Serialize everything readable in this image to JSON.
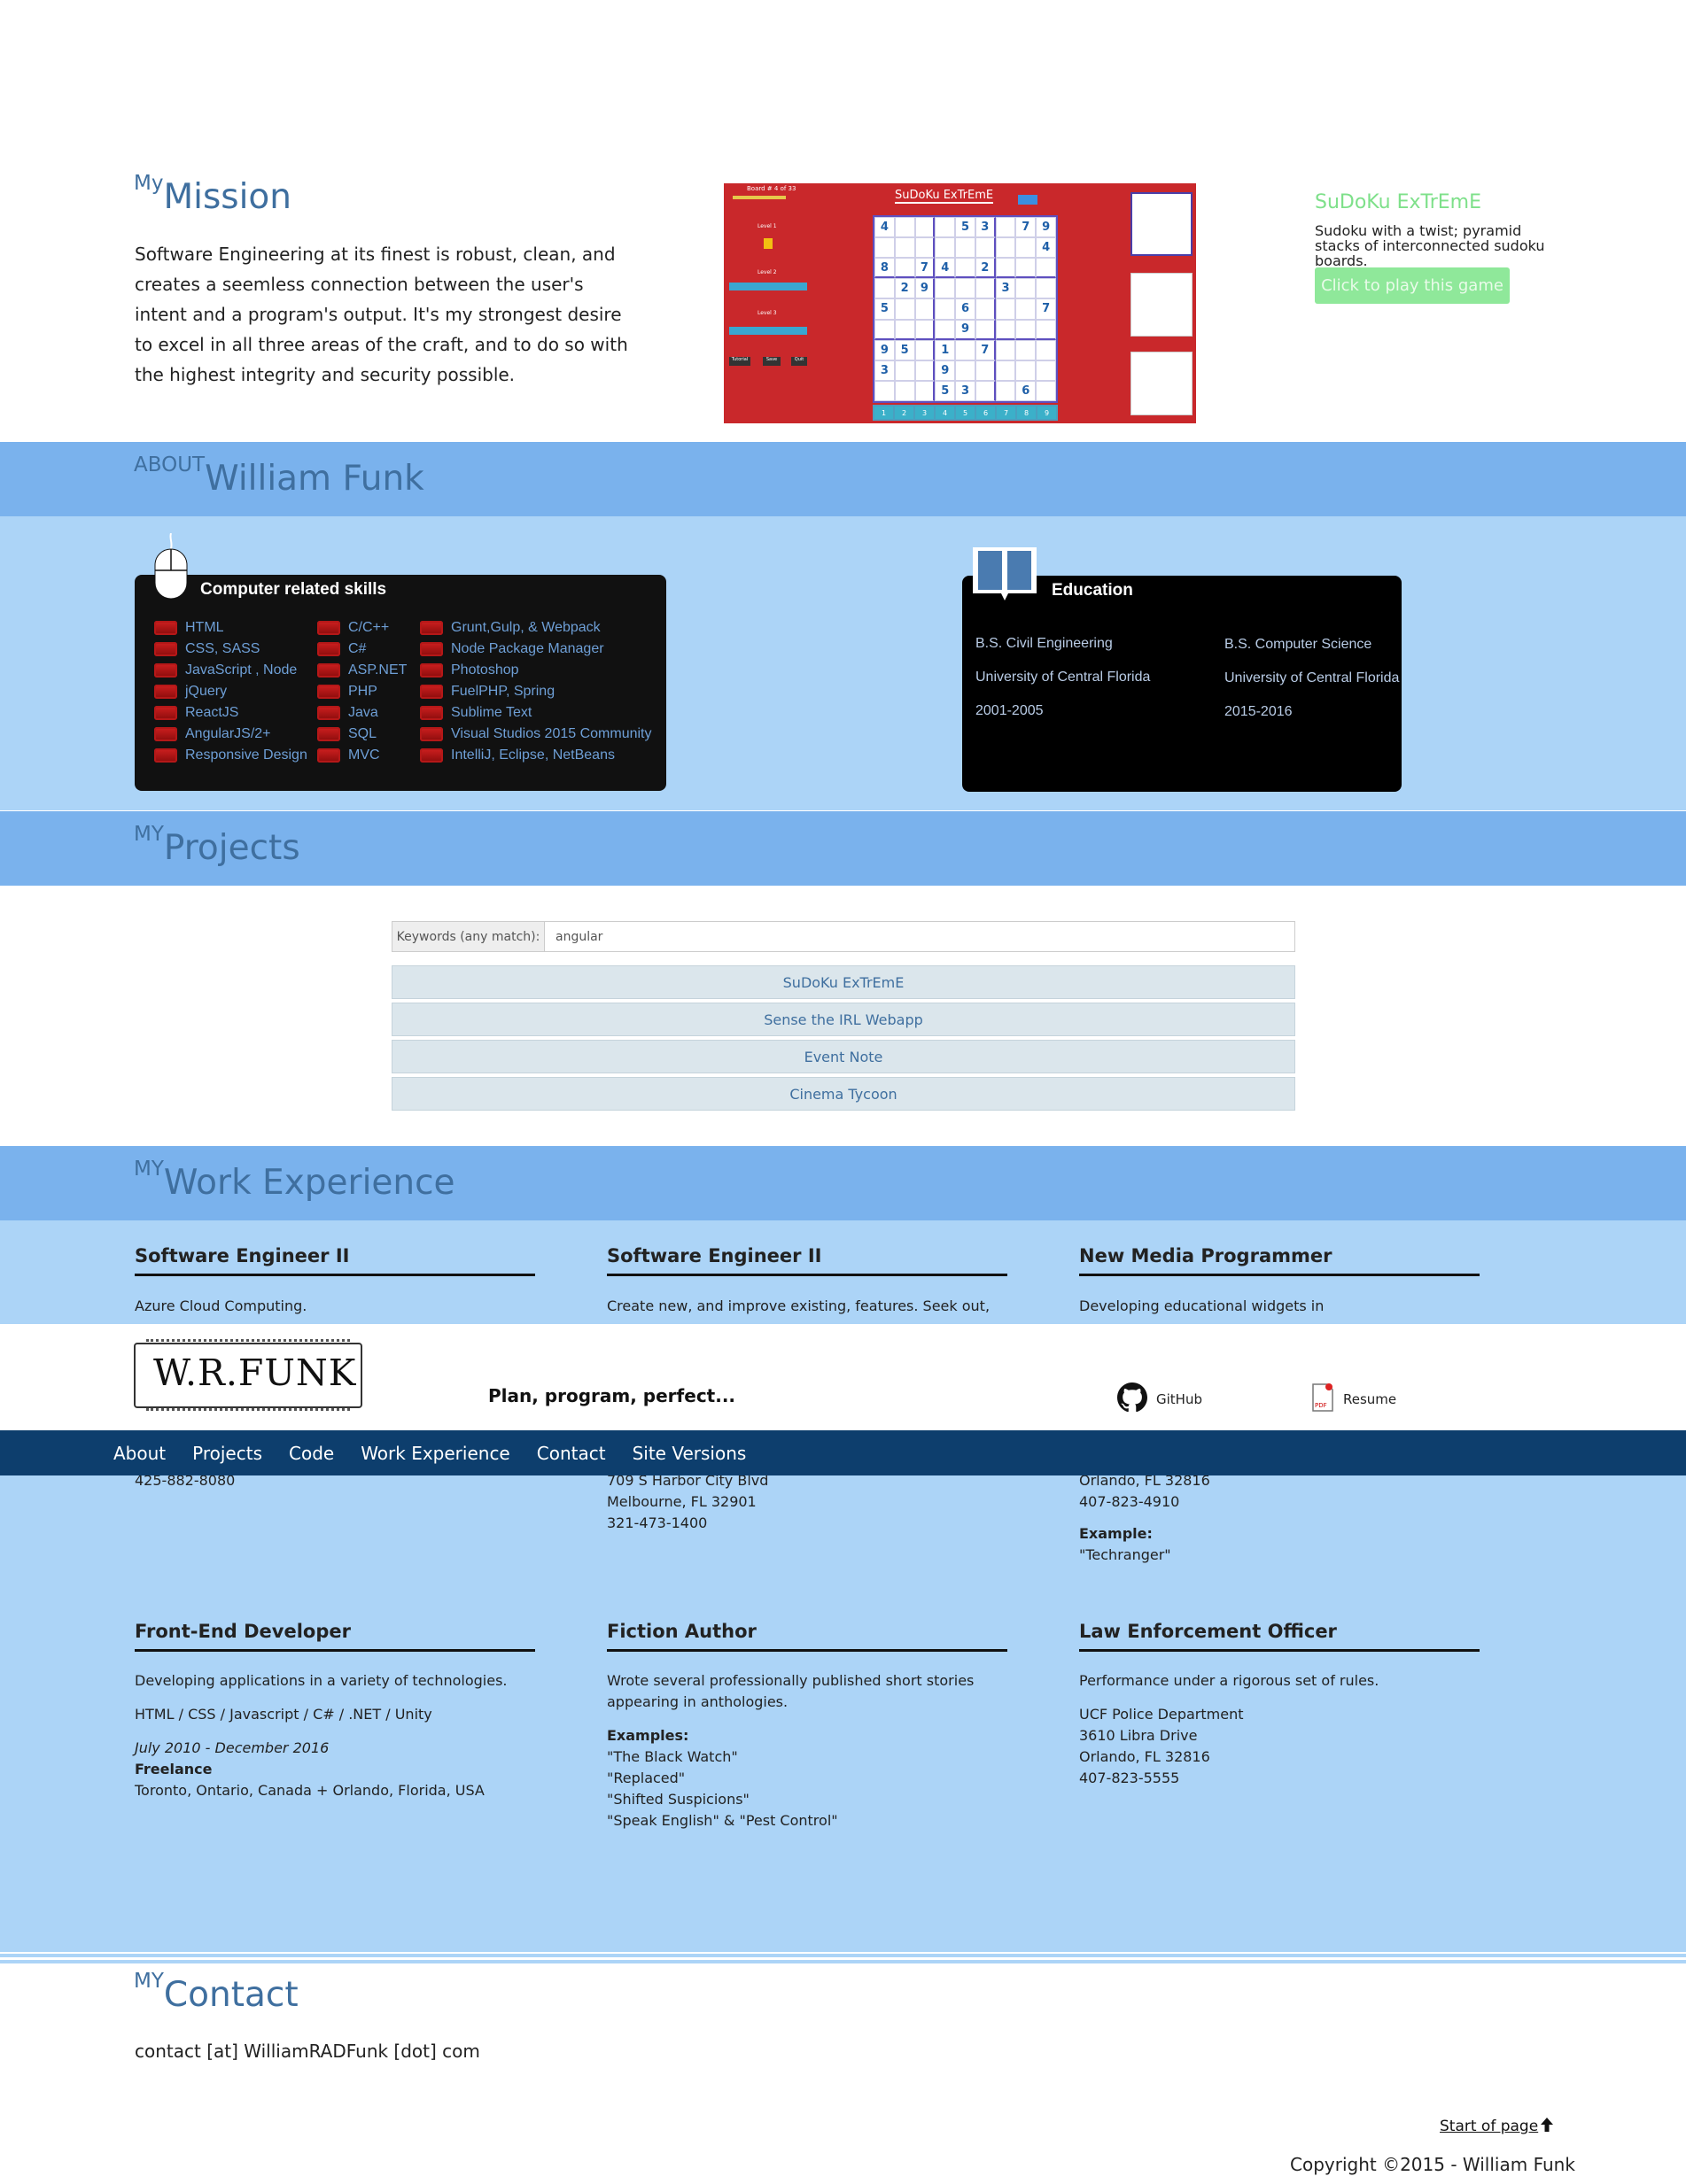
{
  "mission": {
    "small": "My",
    "big": "Mission",
    "text": "Software Engineering at its finest is robust, clean, and creates a seemless connection between the user's intent and a program's output. It's my strongest desire to excel in all three areas of the craft, and to do so with the highest integrity and security possible."
  },
  "preview": {
    "board_label": "Board # 4 of 33",
    "title": "SuDoKu ExTrEmE",
    "level1": "Level 1",
    "level2": "Level 2",
    "level3": "Level 3",
    "buttons": [
      "Tutorial",
      "Save",
      "Quit"
    ],
    "keypad": [
      "1",
      "2",
      "3",
      "4",
      "5",
      "6",
      "7",
      "8",
      "9"
    ],
    "grid": [
      [
        "4",
        "",
        "",
        "",
        "5",
        "3",
        "",
        "7",
        "9"
      ],
      [
        "",
        "",
        "",
        "",
        "",
        "",
        "",
        "",
        "4"
      ],
      [
        "8",
        "",
        "7",
        "4",
        "",
        "2",
        "",
        "",
        ""
      ],
      [
        "",
        "2",
        "9",
        "",
        "",
        "",
        "3",
        "",
        ""
      ],
      [
        "5",
        "",
        "",
        "",
        "6",
        "",
        "",
        "",
        "7"
      ],
      [
        "",
        "",
        "",
        "",
        "9",
        "",
        "",
        "",
        ""
      ],
      [
        "9",
        "5",
        "",
        "1",
        "",
        "7",
        "",
        "",
        ""
      ],
      [
        "3",
        "",
        "",
        "9",
        "",
        "",
        "",
        "",
        ""
      ],
      [
        "",
        "",
        "",
        "5",
        "3",
        "",
        "",
        "6",
        ""
      ]
    ]
  },
  "game": {
    "title": "SuDoKu ExTrEmE",
    "desc": "Sudoku with a twist; pyramid stacks of interconnected sudoku boards.",
    "play": "Click to play this game"
  },
  "about": {
    "small": "ABOUT",
    "big": "William Funk"
  },
  "skills": {
    "heading": "Computer related skills",
    "col1": [
      "HTML",
      "CSS, SASS",
      "JavaScript , Node",
      "jQuery",
      "ReactJS",
      "AngularJS/2+",
      "Responsive Design"
    ],
    "col2": [
      "C/C++",
      "C#",
      "ASP.NET",
      "PHP",
      "Java",
      "SQL",
      "MVC"
    ],
    "col3": [
      "Grunt,Gulp, & Webpack",
      "Node Package Manager",
      "Photoshop",
      "FuelPHP, Spring",
      "Sublime Text",
      "Visual Studios 2015 Community",
      "IntelliJ, Eclipse, NetBeans"
    ]
  },
  "education": {
    "heading": "Education",
    "left": [
      "B.S. Civil Engineering",
      "University of Central Florida",
      "2001-2005"
    ],
    "right": [
      "B.S. Computer Science",
      "University of Central Florida",
      "2015-2016"
    ]
  },
  "projects": {
    "small": "MY",
    "big": "Projects",
    "keyword_label": "Keywords (any match):",
    "keyword_value": "angular",
    "items": [
      "SuDoKu ExTrEmE",
      "Sense the IRL Webapp",
      "Event Note",
      "Cinema Tycoon"
    ]
  },
  "work": {
    "small": "MY",
    "big": "Work Experience",
    "row1": [
      {
        "title": "Software Engineer II",
        "text": "Azure Cloud Computing.",
        "tail": [
          "425-882-8080"
        ]
      },
      {
        "title": "Software Engineer II",
        "text": "Create new, and improve existing, features. Seek out,",
        "tail": [
          "709 S Harbor City Blvd",
          "Melbourne, FL 32901",
          "321-473-1400"
        ]
      },
      {
        "title": "New Media Programmer",
        "text": "Developing educational widgets in",
        "tail": [
          "Orlando, FL 32816",
          "407-823-4910"
        ],
        "example_label": "Example:",
        "example": "\"Techranger\""
      }
    ],
    "row2": [
      {
        "title": "Front-End Developer",
        "text": "Developing applications in a variety of technologies.",
        "tech": "HTML / CSS / Javascript / C# / .NET / Unity",
        "dates": "July 2010 - December 2016",
        "org": "Freelance",
        "place": "Toronto, Ontario, Canada + Orlando, Florida, USA"
      },
      {
        "title": "Fiction Author",
        "text": "Wrote several professionally published short stories appearing in anthologies.",
        "examples_label": "Examples:",
        "examples": [
          "\"The Black Watch\"",
          "\"Replaced\"",
          "\"Shifted Suspicions\"",
          "\"Speak English\" & \"Pest Control\""
        ]
      },
      {
        "title": "Law Enforcement Officer",
        "text": "Performance under a rigorous set of rules.",
        "lines": [
          "UCF Police Department",
          "3610 Libra Drive",
          "Orlando, FL 32816",
          "407-823-5555"
        ]
      }
    ]
  },
  "header": {
    "logo": "W.R.FUNK",
    "tagline": "Plan, program, perfect...",
    "github": "GitHub",
    "resume": "Resume",
    "nav": [
      "About",
      "Projects",
      "Code",
      "Work Experience",
      "Contact",
      "Site Versions"
    ]
  },
  "contact": {
    "small": "MY",
    "big": "Contact",
    "email": "contact [at] WilliamRADFunk [dot] com"
  },
  "footer": {
    "start": "Start of page",
    "copyright": "Copyright ©2015 - William Funk"
  }
}
